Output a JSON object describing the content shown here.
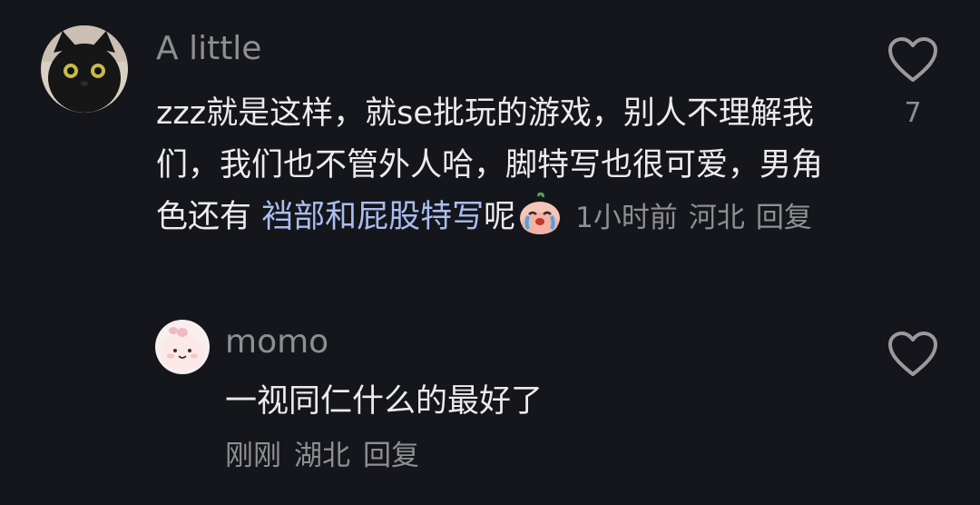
{
  "comments": [
    {
      "author": "A little",
      "text_part1": "zzz就是这样，就se批玩的游戏，别人不理解我们，我们也不管外人哈，脚特写也很可爱，男角色还有 ",
      "text_highlight": "裆部和屁股特写",
      "text_part2": "呢",
      "emoji_icon": "crying-face-icon",
      "time": "1小时前",
      "location": "河北",
      "reply_label": "回复",
      "like_count": "7"
    },
    {
      "author": "momo",
      "text": "一视同仁什么的最好了",
      "time": "刚刚",
      "location": "湖北",
      "reply_label": "回复"
    }
  ],
  "icons": {
    "like": "heart-outline-icon",
    "avatar1": "black-cat-avatar",
    "avatar2": "pink-bun-avatar"
  },
  "colors": {
    "background": "#15161b",
    "text": "#ececec",
    "muted": "#8e8f93",
    "highlight": "#a9bdf0"
  }
}
